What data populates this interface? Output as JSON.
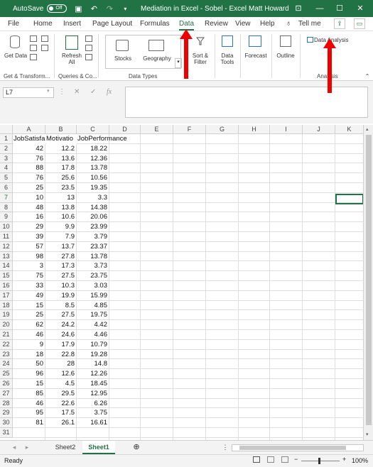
{
  "titlebar": {
    "autosave_label": "AutoSave",
    "autosave_state": "Off",
    "doc_title": "Mediation in Excel - Sobel  -  Excel",
    "user": "Matt Howard"
  },
  "menu": {
    "tabs": [
      "File",
      "Home",
      "Insert",
      "Page Layout",
      "Formulas",
      "Data",
      "Review",
      "View",
      "Help"
    ],
    "active": "Data",
    "tell_me": "Tell me"
  },
  "ribbon": {
    "get_data": "Get Data",
    "refresh_all": "Refresh All",
    "stocks": "Stocks",
    "geography": "Geography",
    "sort_filter": "Sort & Filter",
    "data_tools": "Data Tools",
    "forecast": "Forecast",
    "outline": "Outline",
    "data_analysis": "Data Analysis",
    "groups": {
      "get_transform": "Get & Transform...",
      "queries": "Queries & Co...",
      "data_types": "Data Types",
      "analysis": "Analysis"
    }
  },
  "formula_bar": {
    "name_box": "L7",
    "cancel": "✕",
    "enter": "✓",
    "fx": "fx",
    "value": ""
  },
  "sheet": {
    "columns": [
      "A",
      "B",
      "C",
      "D",
      "E",
      "F",
      "G",
      "H",
      "I",
      "J",
      "K"
    ],
    "headers": [
      "JobSatisfa",
      "Motivatio",
      "JobPerformance"
    ],
    "selected_row": "7",
    "rows": [
      [
        "42",
        "12.2",
        "18.22"
      ],
      [
        "76",
        "13.6",
        "12.36"
      ],
      [
        "88",
        "17.8",
        "13.78"
      ],
      [
        "76",
        "25.6",
        "10.56"
      ],
      [
        "25",
        "23.5",
        "19.35"
      ],
      [
        "10",
        "13",
        "3.3"
      ],
      [
        "48",
        "13.8",
        "14.38"
      ],
      [
        "16",
        "10.6",
        "20.06"
      ],
      [
        "29",
        "9.9",
        "23.99"
      ],
      [
        "39",
        "7.9",
        "3.79"
      ],
      [
        "57",
        "13.7",
        "23.37"
      ],
      [
        "98",
        "27.8",
        "13.78"
      ],
      [
        "3",
        "17.3",
        "3.73"
      ],
      [
        "75",
        "27.5",
        "23.75"
      ],
      [
        "33",
        "10.3",
        "3.03"
      ],
      [
        "49",
        "19.9",
        "15.99"
      ],
      [
        "15",
        "8.5",
        "4.85"
      ],
      [
        "25",
        "27.5",
        "19.75"
      ],
      [
        "62",
        "24.2",
        "4.42"
      ],
      [
        "46",
        "24.6",
        "4.46"
      ],
      [
        "9",
        "17.9",
        "10.79"
      ],
      [
        "18",
        "22.8",
        "19.28"
      ],
      [
        "50",
        "28",
        "14.8"
      ],
      [
        "96",
        "12.6",
        "12.26"
      ],
      [
        "15",
        "4.5",
        "18.45"
      ],
      [
        "85",
        "29.5",
        "12.95"
      ],
      [
        "46",
        "22.6",
        "6.26"
      ],
      [
        "95",
        "17.5",
        "3.75"
      ],
      [
        "81",
        "26.1",
        "16.61"
      ]
    ],
    "row_numbers": [
      "1",
      "2",
      "3",
      "4",
      "5",
      "6",
      "7",
      "8",
      "9",
      "10",
      "11",
      "12",
      "13",
      "14",
      "15",
      "16",
      "17",
      "18",
      "19",
      "20",
      "21",
      "22",
      "23",
      "24",
      "25",
      "26",
      "27",
      "28",
      "29",
      "30",
      "31"
    ]
  },
  "tabs": {
    "sheets": [
      "Sheet2",
      "Sheet1"
    ],
    "active": "Sheet1"
  },
  "status": {
    "ready": "Ready",
    "zoom": "100%"
  },
  "accent": "#217346",
  "annotation_color": "#e00000"
}
